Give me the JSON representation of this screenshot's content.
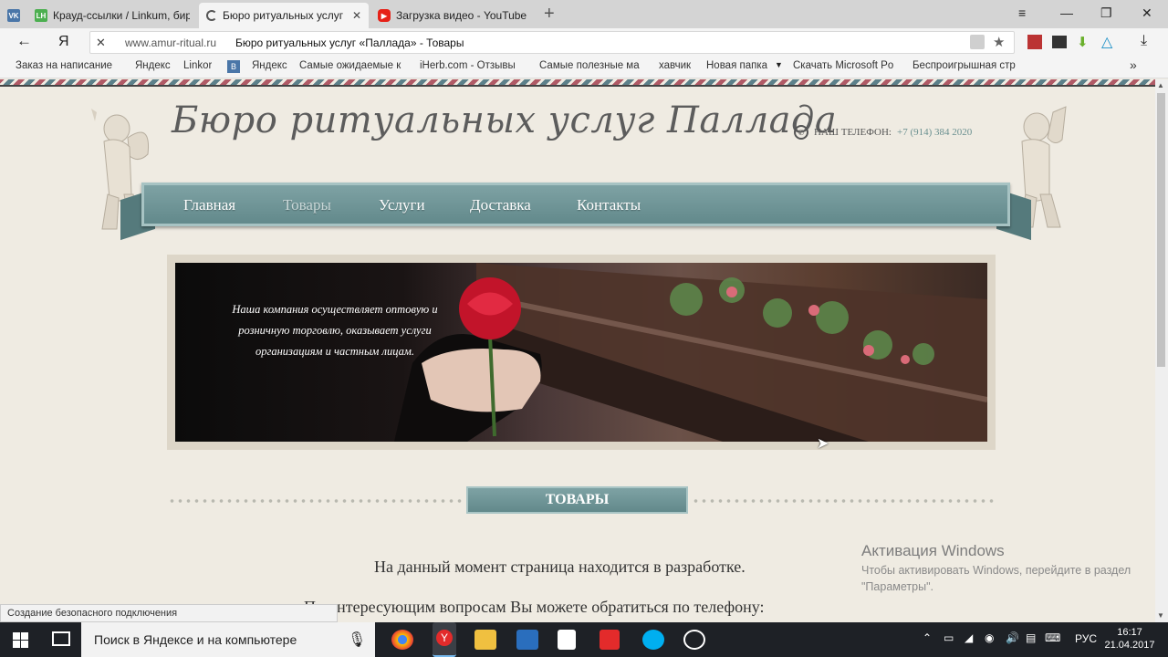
{
  "browser": {
    "tabs": [
      {
        "label": "",
        "icon": "vk-icon"
      },
      {
        "label": "Крауд-ссылки / Linkum, бир",
        "icon": "linkum-icon"
      },
      {
        "label": "Бюро ритуальных услуг",
        "icon": "loading-icon",
        "active": true
      },
      {
        "label": "Загрузка видео - YouTube",
        "icon": "youtube-icon"
      }
    ],
    "back_label": "←",
    "yandex_logo": "Я",
    "url": "www.amur-ritual.ru",
    "page_title": "Бюро ритуальных услуг «Паллада» - Товары",
    "bookmarks": [
      "Заказ на написание",
      "Яндекс",
      "Linkor",
      "Яндекс",
      "Самые ожидаемые к",
      "iHerb.com - Отзывы",
      "Самые полезные ма",
      "хавчик",
      "Новая папка",
      "Скачать Microsoft Po",
      "Беспроигрышная стр"
    ],
    "more_bookmarks": "»",
    "status_text": "Создание безопасного подключения"
  },
  "site": {
    "brand": "Бюро ритуальных услуг Паллада",
    "phone_label": "НАШ ТЕЛЕФОН:",
    "phone_number": "+7 (914) 384 2020",
    "nav": [
      "Главная",
      "Товары",
      "Услуги",
      "Доставка",
      "Контакты"
    ],
    "nav_current_index": 1,
    "banner_text": "Наша компания осуществляет оптовую и розничную торговлю, оказывает услуги организациям и частным лицам.",
    "section_title": "ТОВАРЫ",
    "text_1": "На данный момент страница находится в разработке.",
    "text_2": "По интересующим вопросам Вы можете обратиться по телефону:"
  },
  "windows": {
    "activation_title": "Активация Windows",
    "activation_text": "Чтобы активировать Windows, перейдите в раздел \"Параметры\".",
    "search_placeholder": "Поиск в Яндексе и на компьютере",
    "language": "РУС",
    "time": "16:17",
    "date": "21.04.2017"
  },
  "colors": {
    "ribbon": "#6f9596",
    "page_bg": "#efebe2",
    "accent_red": "#b05a66"
  }
}
